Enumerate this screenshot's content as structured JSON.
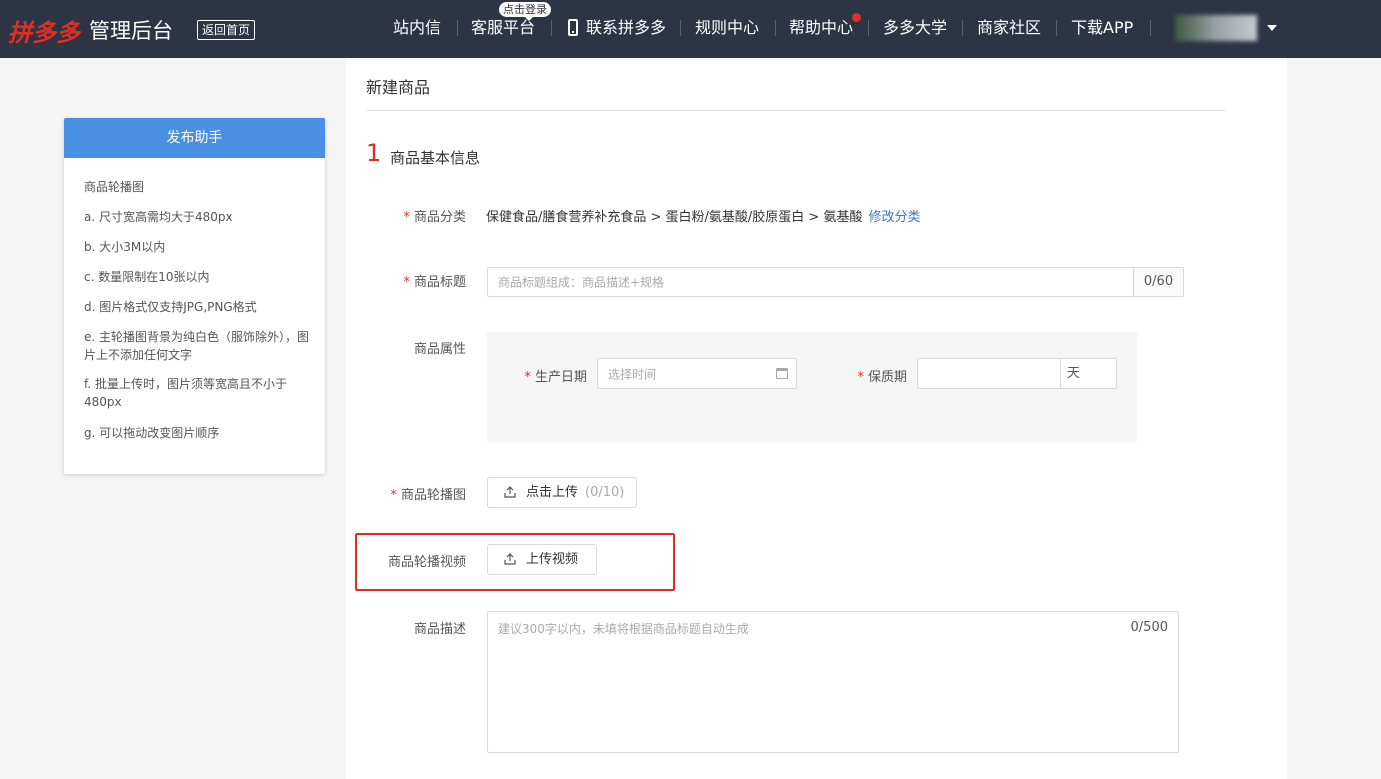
{
  "header": {
    "logo_brand": "拼多多",
    "logo_suffix": "管理后台",
    "home_button": "返回首页",
    "login_tip": "点击登录",
    "nav": {
      "messages": "站内信",
      "service": "客服平台",
      "contact": "联系拼多多",
      "rules": "规则中心",
      "help": "帮助中心",
      "university": "多多大学",
      "community": "商家社区",
      "download": "下载APP"
    }
  },
  "assistant": {
    "title": "发布助手",
    "lines": [
      "商品轮播图",
      "a. 尺寸宽高需均大于480px",
      "b. 大小3M以内",
      "c. 数量限制在10张以内",
      "d. 图片格式仅支持JPG,PNG格式",
      "e. 主轮播图背景为纯白色（服饰除外），图片上不添加任何文字",
      "f. 批量上传时，图片须等宽高且不小于480px",
      "g. 可以拖动改变图片顺序"
    ]
  },
  "form": {
    "page_title": "新建商品",
    "step_number": "1",
    "step_title": "商品基本信息",
    "required_mark": "*",
    "category": {
      "label": "商品分类",
      "path": "保健食品/膳食营养补充食品 > 蛋白粉/氨基酸/胶原蛋白 > 氨基酸",
      "edit_link": "修改分类"
    },
    "title_field": {
      "label": "商品标题",
      "placeholder": "商品标题组成：商品描述+规格",
      "counter": "0/60"
    },
    "attributes": {
      "label": "商品属性",
      "production_date_label": "生产日期",
      "production_date_placeholder": "选择时间",
      "shelf_life_label": "保质期",
      "shelf_life_unit": "天"
    },
    "carousel_images": {
      "label": "商品轮播图",
      "button": "点击上传",
      "count": "(0/10)"
    },
    "carousel_video": {
      "label": "商品轮播视频",
      "button": "上传视频"
    },
    "description": {
      "label": "商品描述",
      "placeholder": "建议300字以内，未填将根据商品标题自动生成",
      "counter": "0/500"
    }
  },
  "colors": {
    "topbar": "#2d3444",
    "brand_red": "#e02e24",
    "assistant_header": "#4a90e2",
    "link": "#3a78c4"
  },
  "icons": [
    "phone-icon",
    "caret-down-icon",
    "calendar-icon",
    "upload-icon"
  ]
}
